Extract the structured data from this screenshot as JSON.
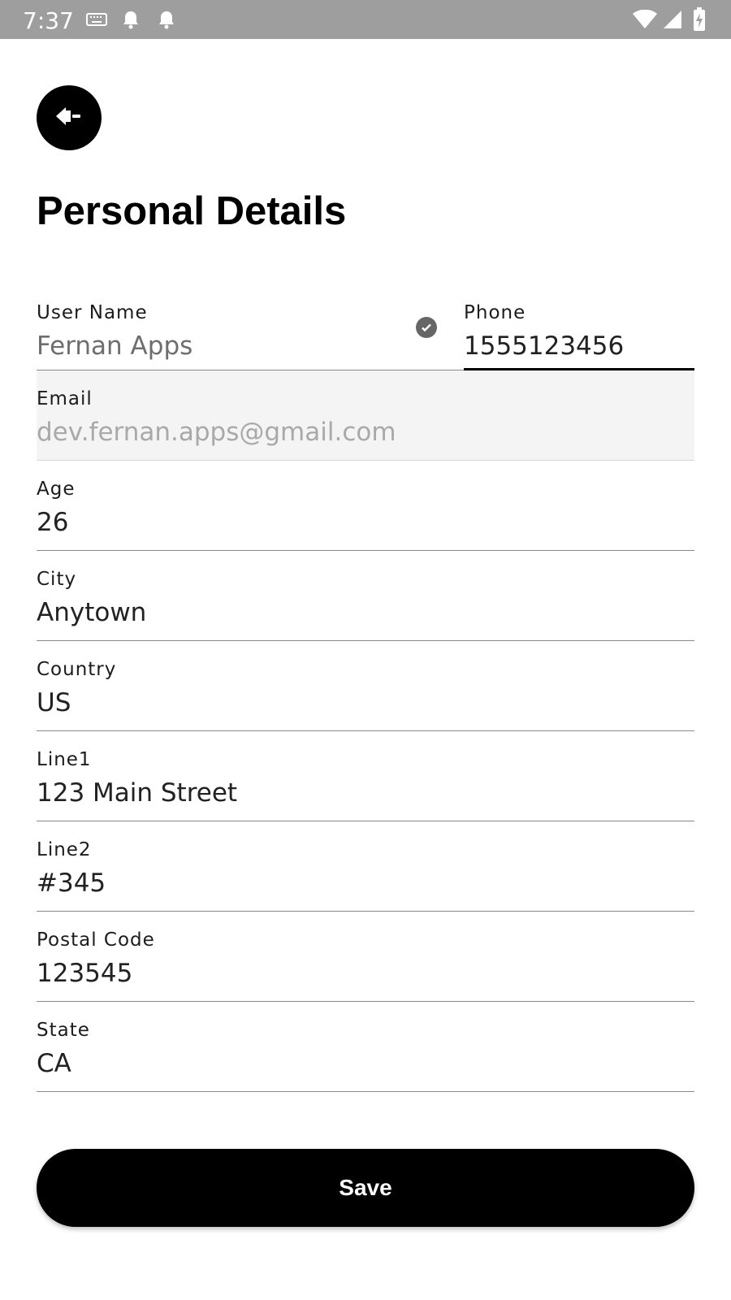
{
  "status_bar": {
    "time": "7:37",
    "left_icons": [
      "keyboard-icon",
      "notification-bell-icon",
      "notification-bell-icon"
    ],
    "right_icons": [
      "wifi-icon",
      "cell-signal-icon",
      "battery-charging-icon"
    ]
  },
  "header": {
    "back_icon": "back-arrow-icon",
    "title": "Personal Details"
  },
  "form": {
    "user_name": {
      "label": "User Name",
      "value": "Fernan Apps",
      "verified_icon": "check-circle-icon"
    },
    "phone": {
      "label": "Phone",
      "value": "1555123456"
    },
    "email": {
      "label": "Email",
      "value": "dev.fernan.apps@gmail.com"
    },
    "age": {
      "label": "Age",
      "value": "26"
    },
    "city": {
      "label": "City",
      "value": "Anytown"
    },
    "country": {
      "label": "Country",
      "value": "US"
    },
    "line1": {
      "label": "Line1",
      "value": "123 Main Street"
    },
    "line2": {
      "label": "Line2",
      "value": "#345"
    },
    "postal_code": {
      "label": "Postal Code",
      "value": "123545"
    },
    "state": {
      "label": "State",
      "value": "CA"
    }
  },
  "save_button": {
    "label": "Save"
  },
  "colors": {
    "status_bar": "#9e9e9e",
    "accent": "#000000",
    "disabled_field_bg": "#f4f4f4"
  }
}
